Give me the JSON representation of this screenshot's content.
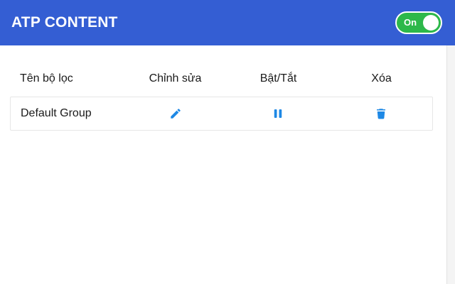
{
  "header": {
    "title": "ATP CONTENT",
    "toggle_label": "On",
    "toggle_state": "on"
  },
  "table": {
    "columns": [
      "Tên bộ lọc",
      "Chỉnh sửa",
      "Bật/Tắt",
      "Xóa"
    ],
    "rows": [
      {
        "name": "Default Group",
        "edit_icon": "pencil-icon",
        "toggle_icon": "pause-icon",
        "delete_icon": "trash-icon"
      }
    ]
  },
  "colors": {
    "header_bg": "#345ed3",
    "toggle_on": "#2db84a",
    "icon_blue": "#1e88e5"
  }
}
